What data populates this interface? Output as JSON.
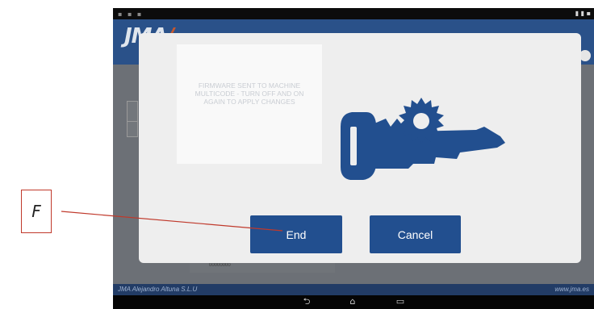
{
  "app": {
    "brand_logo": "JMA",
    "footer_left": "JMA Alejandro Altuna S.L.U",
    "footer_right": "www.jma.es",
    "bottom_field": "00000000"
  },
  "modal": {
    "message": "FIRMWARE SENT TO MACHINE MULTICODE - TURN OFF AND ON AGAIN TO APPLY CHANGES",
    "end_label": "End",
    "cancel_label": "Cancel",
    "illustration_icon": "key-with-blade-icon"
  },
  "annotation": {
    "label": "F"
  },
  "colors": {
    "button": "#224f8f",
    "key_illustration": "#224f8f",
    "appbar": "#2a5189",
    "callout_border": "#c0392b"
  }
}
